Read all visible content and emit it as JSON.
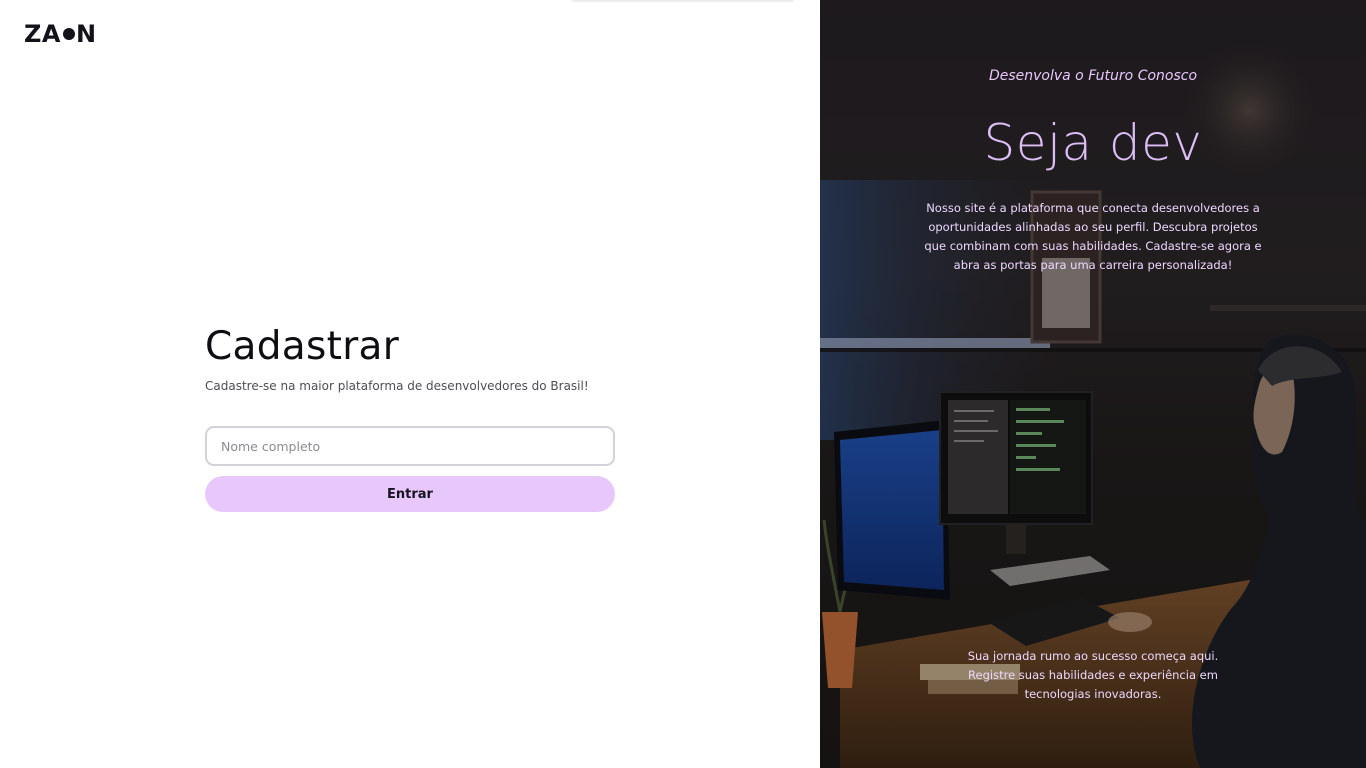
{
  "logo": {
    "prefix": "ZA",
    "suffix": "N"
  },
  "form": {
    "title": "Cadastrar",
    "subtitle": "Cadastre-se na maior plataforma de desenvolvedores do Brasil!",
    "name_input": {
      "value": "",
      "placeholder": "Nome completo"
    },
    "submit_label": "Entrar"
  },
  "promo": {
    "tagline": "Desenvolva o Futuro Conosco",
    "hero": "Seja dev",
    "description": "Nosso site é a plataforma que conecta desenvolvedores a oportunidades alinhadas ao seu perfil. Descubra projetos que combinam com suas habilidades. Cadastre-se agora e abra as portas para uma carreira personalizada!",
    "bottom": "Sua jornada rumo ao sucesso começa aqui. Registre suas habilidades e experiência em tecnologias inovadoras."
  },
  "colors": {
    "accent": "#e8c8fc",
    "accent_text": "#dcbdf4",
    "ink": "#12131a"
  }
}
